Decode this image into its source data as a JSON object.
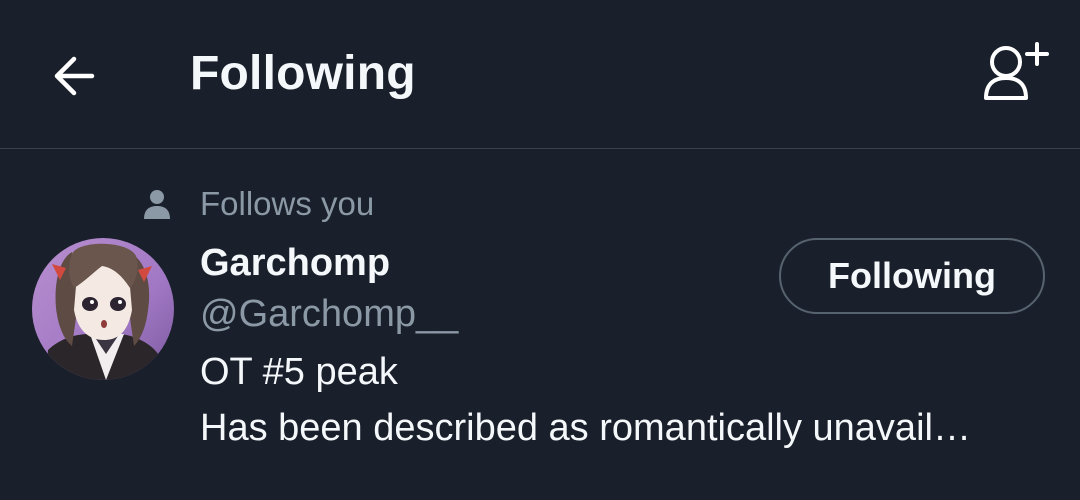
{
  "header": {
    "title": "Following",
    "back_icon": "arrow-left-icon",
    "add_icon": "add-user-icon"
  },
  "list": [
    {
      "follows_you_label": "Follows you",
      "follows_icon": "person-icon",
      "name": "Garchomp",
      "handle": "@Garchomp__",
      "bio_line_1": "OT #5 peak",
      "bio_line_2": "Has been described as romantically unavail…",
      "button_label": "Following"
    }
  ],
  "colors": {
    "background": "#1a202b",
    "divider": "#38424f",
    "secondary_text": "#8b98a5",
    "primary_text": "#f5f8fa",
    "button_border": "#56636f"
  }
}
